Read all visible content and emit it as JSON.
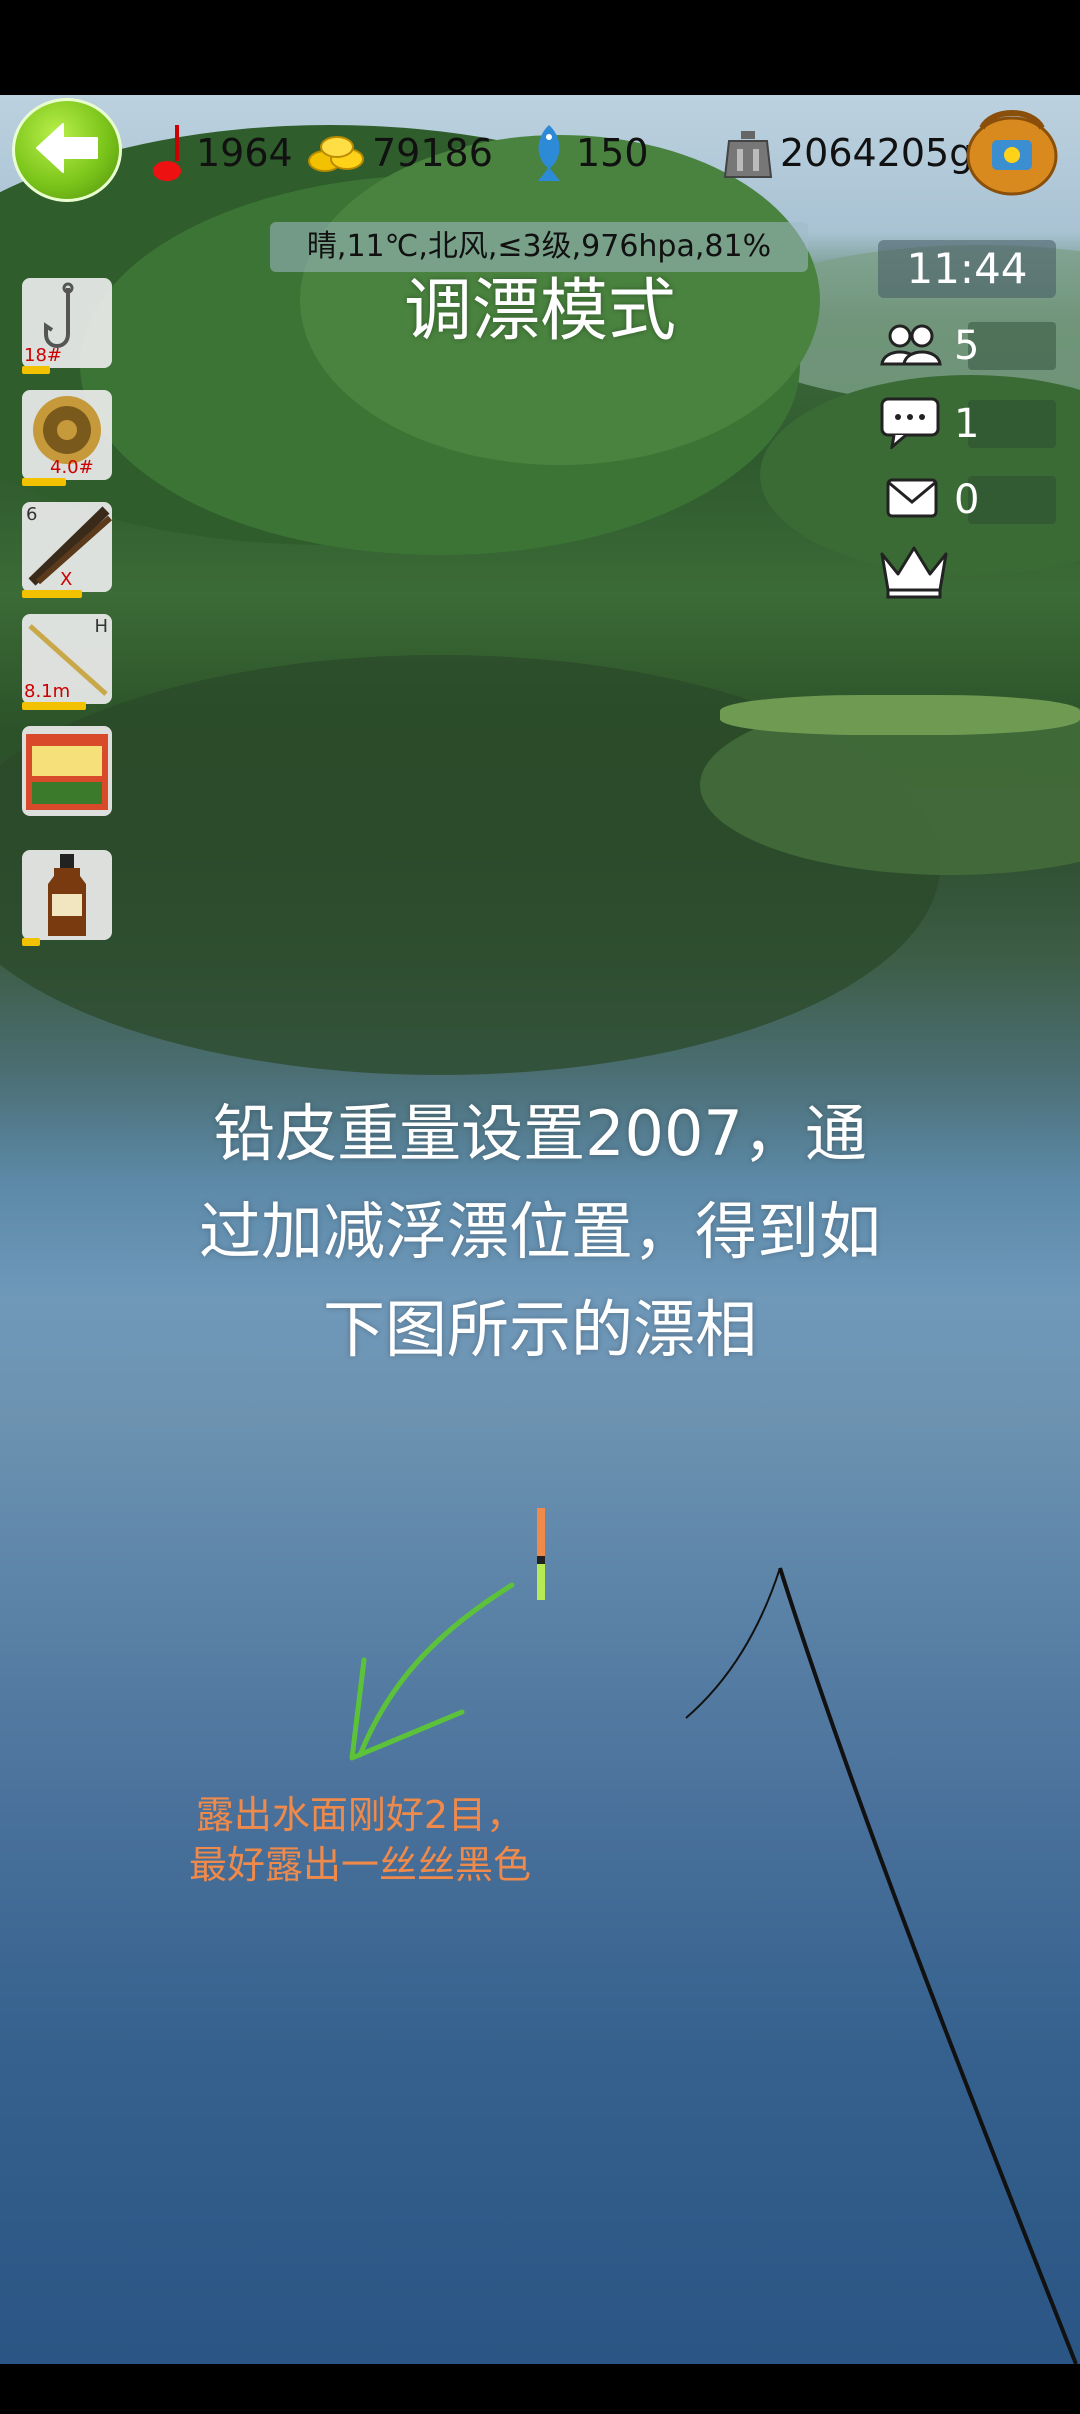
{
  "stats": {
    "level": "1964",
    "gold": "79186",
    "fish": "150",
    "weight": "2064205g"
  },
  "weather": "晴,11℃,北风,≤3级,976hpa,81%",
  "mode_title": "调漂模式",
  "time": "11:44",
  "side_panel": {
    "friends_count": "5",
    "messages_count": "1",
    "mail_count": "0"
  },
  "tools": {
    "hook_label": "18#",
    "line_label": "4.0#",
    "lead_top": "6",
    "lead_label": "X",
    "rod_top": "H",
    "rod_label": "8.1m"
  },
  "instruction": [
    "铅皮重量设置2007，通",
    "过加减浮漂位置，得到如",
    "下图所示的漂相"
  ],
  "note": [
    "露出水面刚好2目，",
    "最好露出一丝丝黑色"
  ],
  "icons": {
    "back": "back-arrow-icon",
    "level": "float-level-icon",
    "gold": "gold-coins-icon",
    "fish": "fish-icon",
    "weight": "weight-scale-icon",
    "bag": "backpack-icon",
    "friends": "friends-icon",
    "chat": "chat-icon",
    "mail": "mail-icon",
    "crown": "crown-icon"
  },
  "colors": {
    "back_green": "#7cc51b",
    "note_orange": "#f08a4a",
    "arrow_green": "#5cc23a",
    "float_orange": "#f08a4a",
    "float_green": "#b6ea55"
  }
}
